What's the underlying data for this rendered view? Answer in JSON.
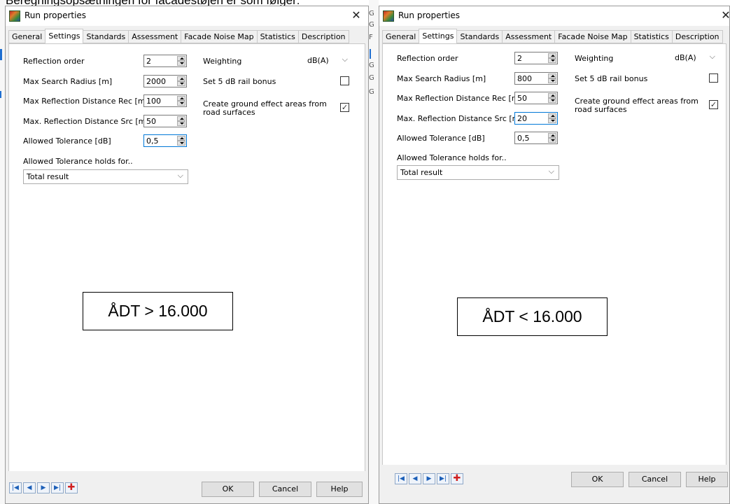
{
  "caption": "Beregningsopsætningen for facadestøjen er som følger:",
  "separator_letters": [
    "G",
    "G",
    "F",
    "G",
    "G",
    "G"
  ],
  "windows": [
    {
      "title": "Run properties",
      "tabs": [
        "General",
        "Settings",
        "Standards",
        "Assessment",
        "Facade Noise Map",
        "Statistics",
        "Description"
      ],
      "active_tab": "Settings",
      "reflection_order_label": "Reflection order",
      "reflection_order": "2",
      "max_search_radius_label": "Max Search Radius [m]",
      "max_search_radius": "2000",
      "max_refl_dist_rec_label": "Max Reflection Distance Rec [m]",
      "max_refl_dist_rec": "100",
      "max_refl_dist_src_label": "Max. Reflection Distance Src [m]",
      "max_refl_dist_src": "50",
      "allowed_tolerance_label": "Allowed Tolerance [dB]",
      "allowed_tolerance": "0,5",
      "tolerance_holds_label": "Allowed Tolerance holds for..",
      "tolerance_holds_value": "Total result",
      "weighting_label": "Weighting",
      "weighting_value": "dB(A)",
      "rail_bonus_label": "Set 5 dB rail bonus",
      "rail_bonus_checked": false,
      "ground_effect_label_1": "Create ground effect areas from",
      "ground_effect_label_2": "road surfaces",
      "ground_effect_checked": true,
      "annotation": "ÅDT > 16.000",
      "ok_label": "OK",
      "cancel_label": "Cancel",
      "help_label": "Help",
      "nav_first": "|◀",
      "nav_prev": "◀",
      "nav_next": "▶",
      "nav_last": "▶|",
      "nav_add": "✚",
      "close_glyph": "✕",
      "chevron": "⌵",
      "check_glyph": "✓"
    },
    {
      "title": "Run properties",
      "tabs": [
        "General",
        "Settings",
        "Standards",
        "Assessment",
        "Facade Noise Map",
        "Statistics",
        "Description"
      ],
      "active_tab": "Settings",
      "reflection_order_label": "Reflection order",
      "reflection_order": "2",
      "max_search_radius_label": "Max Search Radius [m]",
      "max_search_radius": "800",
      "max_refl_dist_rec_label": "Max Reflection Distance Rec [m]",
      "max_refl_dist_rec": "50",
      "max_refl_dist_src_label": "Max. Reflection Distance Src [m]",
      "max_refl_dist_src": "20",
      "allowed_tolerance_label": "Allowed Tolerance [dB]",
      "allowed_tolerance": "0,5",
      "tolerance_holds_label": "Allowed Tolerance holds for..",
      "tolerance_holds_value": "Total result",
      "weighting_label": "Weighting",
      "weighting_value": "dB(A)",
      "rail_bonus_label": "Set 5 dB rail bonus",
      "rail_bonus_checked": false,
      "ground_effect_label_1": "Create ground effect areas from",
      "ground_effect_label_2": "road surfaces",
      "ground_effect_checked": true,
      "annotation": "ÅDT < 16.000",
      "ok_label": "OK",
      "cancel_label": "Cancel",
      "help_label": "Help",
      "nav_first": "|◀",
      "nav_prev": "◀",
      "nav_next": "▶",
      "nav_last": "▶|",
      "nav_add": "✚",
      "close_glyph": "✕",
      "chevron": "⌵",
      "check_glyph": "✓"
    }
  ]
}
